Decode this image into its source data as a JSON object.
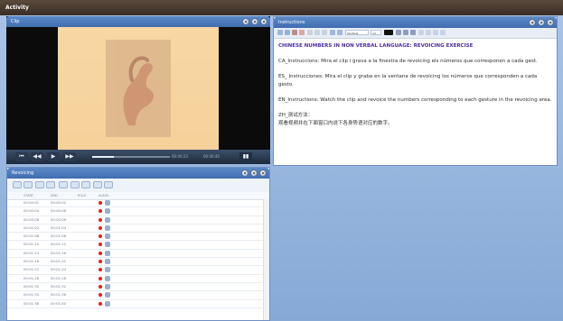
{
  "app": {
    "title": "Activity"
  },
  "clip": {
    "title": "Clip",
    "time_current": "00:00:23",
    "time_total": "00:00:40",
    "progress": 0.28
  },
  "instructions": {
    "title": "Instructions",
    "font_select": "Verdana",
    "size_select": "14",
    "heading": "CHINESE NUMBERS IN NON VERBAL LANGUAGE: REVOICING EXERCISE",
    "ca": "CA_Instruccions:  Mira el clip i grava a la finestra de revoicing els números que corresponen a cada gest.",
    "es": "ES_ Instrucciones: Mira el clip y graba en la ventana de revoicing los números que corresponden a cada gesto.",
    "en": "EN_Instructions: Watch the clip and revoice the numbers corresponding to each gesture in the revoicing area.",
    "zh_title": "ZH_测试方法：",
    "zh_body": "观看视频并在下面窗口内说下各身势语对应的数字。"
  },
  "revoicing": {
    "title": "Revoicing",
    "columns": [
      "START",
      "END",
      "ROLE",
      "AUDIO"
    ],
    "rows": [
      {
        "start": "00:00:01",
        "end": "00:00:02"
      },
      {
        "start": "00:00:04",
        "end": "00:00:06"
      },
      {
        "start": "00:00:08",
        "end": "00:00:09"
      },
      {
        "start": "00:01:02",
        "end": "00:01:04"
      },
      {
        "start": "00:01:06",
        "end": "00:01:08"
      },
      {
        "start": "00:01:10",
        "end": "00:01:12"
      },
      {
        "start": "00:01:14",
        "end": "00:01:16"
      },
      {
        "start": "00:01:18",
        "end": "00:01:22"
      },
      {
        "start": "00:01:22",
        "end": "00:01:24"
      },
      {
        "start": "00:01:26",
        "end": "00:01:28"
      },
      {
        "start": "00:01:30",
        "end": "00:01:32"
      },
      {
        "start": "00:01:34",
        "end": "00:01:36"
      },
      {
        "start": "00:01:38",
        "end": "00:01:40"
      }
    ]
  }
}
